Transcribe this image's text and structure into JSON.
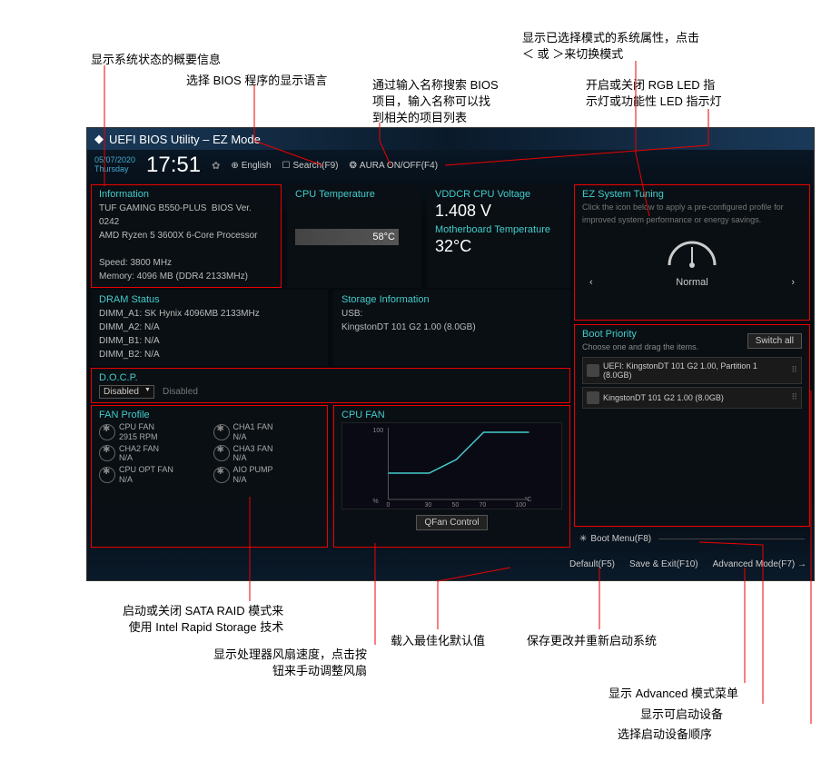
{
  "annotations": {
    "top_left": "显示系统状态的概要信息",
    "top_lang": "选择 BIOS 程序的显示语言",
    "top_search": "通过输入名称搜索 BIOS\n项目，输入名称可以找\n到相关的项目列表",
    "top_mode": "显示已选择模式的系统属性，点击\n＜ 或 ＞来切换模式",
    "top_aura": "开启或关闭 RGB LED 指\n示灯或功能性 LED 指示灯",
    "bot_raid": "启动或关闭 SATA RAID 模式来\n使用 Intel Rapid Storage 技术",
    "bot_fan": "显示处理器风扇速度，点击按\n钮来手动调整风扇",
    "bot_default": "载入最佳化默认值",
    "bot_save": "保存更改并重新启动系统",
    "bot_adv": "显示 Advanced 模式菜单",
    "bot_boot": "显示可启动设备",
    "bot_priority": "选择启动设备顺序"
  },
  "header": {
    "title": "UEFI BIOS Utility – EZ Mode",
    "date": "05/07/2020",
    "day": "Thursday",
    "time": "17:51",
    "lang": "English",
    "search": "Search(F9)",
    "aura": "AURA ON/OFF(F4)"
  },
  "info": {
    "title": "Information",
    "board": "TUF GAMING B550-PLUS",
    "bios_ver": "BIOS Ver. 0242",
    "cpu": "AMD Ryzen 5 3600X 6-Core Processor",
    "speed": "Speed: 3800 MHz",
    "memory": "Memory: 4096 MB (DDR4 2133MHz)"
  },
  "cpu_temp": {
    "title": "CPU Temperature",
    "value": "58°C"
  },
  "vddcr": {
    "title": "VDDCR CPU Voltage",
    "value": "1.408 V",
    "mb_title": "Motherboard Temperature",
    "mb_value": "32°C"
  },
  "dram": {
    "title": "DRAM Status",
    "a1": "DIMM_A1: SK Hynix 4096MB 2133MHz",
    "a2": "DIMM_A2: N/A",
    "b1": "DIMM_B1: N/A",
    "b2": "DIMM_B2: N/A"
  },
  "storage": {
    "title": "Storage Information",
    "usb_label": "USB:",
    "usb_item": "KingstonDT 101 G2 1.00 (8.0GB)"
  },
  "docp": {
    "title": "D.O.C.P.",
    "value": "Disabled",
    "status": "Disabled"
  },
  "fan_profile": {
    "title": "FAN Profile",
    "cpu_fan": "CPU FAN",
    "cpu_rpm": "2915 RPM",
    "cha1": "CHA1 FAN",
    "cha2": "CHA2 FAN",
    "cha3": "CHA3 FAN",
    "opt": "CPU OPT FAN",
    "aio": "AIO PUMP",
    "na": "N/A"
  },
  "cpu_fan_chart": {
    "title": "CPU FAN",
    "btn": "QFan Control"
  },
  "chart_data": {
    "type": "line",
    "title": "CPU FAN",
    "xlabel": "°C",
    "ylabel": "%",
    "xlim": [
      0,
      100
    ],
    "ylim": [
      0,
      100
    ],
    "x_ticks": [
      0,
      30,
      50,
      70,
      100
    ],
    "points": [
      {
        "x": 0,
        "y": 40
      },
      {
        "x": 30,
        "y": 40
      },
      {
        "x": 50,
        "y": 60
      },
      {
        "x": 70,
        "y": 100
      },
      {
        "x": 100,
        "y": 100
      }
    ]
  },
  "ez_tuning": {
    "title": "EZ System Tuning",
    "desc": "Click the icon below to apply a pre-configured profile for improved system performance or energy savings.",
    "mode": "Normal"
  },
  "boot_priority": {
    "title": "Boot Priority",
    "desc": "Choose one and drag the items.",
    "switch": "Switch all",
    "item1": "UEFI: KingstonDT 101 G2 1.00, Partition 1 (8.0GB)",
    "item2": "KingstonDT 101 G2 1.00 (8.0GB)"
  },
  "boot_menu": "Boot Menu(F8)",
  "footer": {
    "default": "Default(F5)",
    "save": "Save & Exit(F10)",
    "advanced": "Advanced Mode(F7)"
  }
}
